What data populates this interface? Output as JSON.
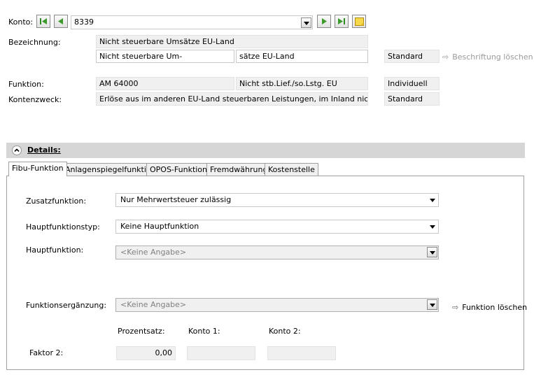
{
  "header": {
    "konto_label": "Konto:",
    "konto_value": "8339",
    "bezeichnung_label": "Bezeichnung:",
    "bezeichnung_full": "Nicht steuerbare Umsätze EU-Land",
    "bezeichnung_part1": "Nicht steuerbare Um-",
    "bezeichnung_part2": "sätze EU-Land",
    "bezeichnung_status": "Standard",
    "beschriftung_loeschen": "Beschriftung löschen",
    "funktion_label": "Funktion:",
    "funktion_code": "AM  64000",
    "funktion_text": "Nicht stb.Lief./so.Lstg. EU",
    "funktion_status": "Individuell",
    "kontenzweck_label": "Kontenzweck:",
    "kontenzweck_text": "Erlöse aus im anderen EU-Land steuerbaren Leistungen, im Inland nicht steuerba",
    "kontenzweck_status": "Standard"
  },
  "details": {
    "title": "Details:",
    "tabs": [
      "Fibu-Funktion",
      "Anlagenspiegelfunktion",
      "OPOS-Funktion",
      "Fremdwährung",
      "Kostenstelle"
    ]
  },
  "fibu": {
    "zusatzfunktion_label": "Zusatzfunktion:",
    "zusatzfunktion_value": "Nur Mehrwertsteuer zulässig",
    "hauptfunktionstyp_label": "Hauptfunktionstyp:",
    "hauptfunktionstyp_value": "Keine Hauptfunktion",
    "hauptfunktion_label": "Hauptfunktion:",
    "hauptfunktion_value": "<Keine Angabe>",
    "funktionsergaenzung_label": "Funktionsergänzung:",
    "funktionsergaenzung_value": "<Keine Angabe>",
    "funktion_loeschen": "Funktion löschen",
    "prozentsatz_label": "Prozentsatz:",
    "konto1_label": "Konto 1:",
    "konto2_label": "Konto 2:",
    "faktor2_label": "Faktor 2:",
    "prozentsatz_value": "0,00",
    "konto1_value": "",
    "konto2_value": ""
  },
  "colors": {
    "nav_arrow_green": "#3c9a2a",
    "note_yellow": "#f7d84a",
    "details_bar": "#d6d6d6"
  }
}
